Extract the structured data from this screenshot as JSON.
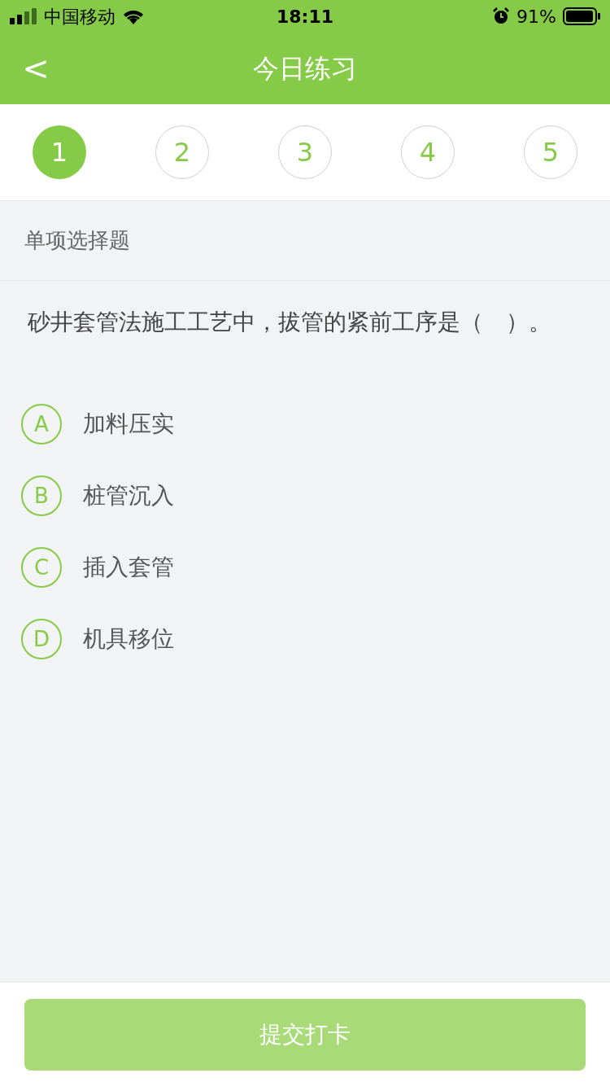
{
  "status_bar": {
    "carrier": "中国移动",
    "time": "18:11",
    "battery": "91%"
  },
  "header": {
    "back": "<",
    "title": "今日练习"
  },
  "steps": [
    {
      "label": "1",
      "selected": true
    },
    {
      "label": "2",
      "selected": false
    },
    {
      "label": "3",
      "selected": false
    },
    {
      "label": "4",
      "selected": false
    },
    {
      "label": "5",
      "selected": false
    }
  ],
  "section": "单项选择题",
  "question": "砂井套管法施工工艺中，拔管的紧前工序是（　）。",
  "options": [
    {
      "letter": "A",
      "text": "加料压实",
      "selected": false
    },
    {
      "letter": "B",
      "text": "桩管沉入",
      "selected": false
    },
    {
      "letter": "C",
      "text": "插入套管",
      "selected": false
    },
    {
      "letter": "D",
      "text": "机具移位",
      "selected": false
    }
  ],
  "submit": {
    "label": "提交打卡",
    "disabled": true
  }
}
